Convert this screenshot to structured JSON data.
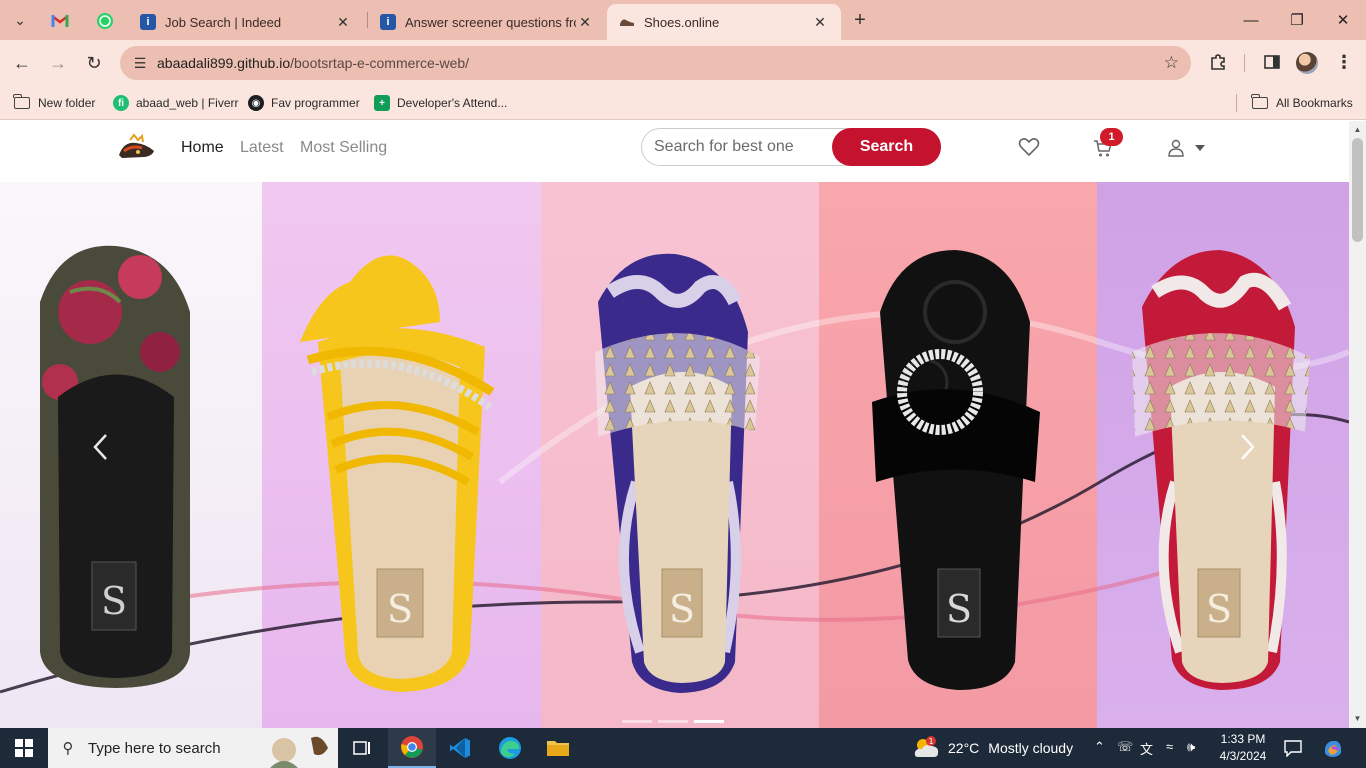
{
  "browser": {
    "tabs": [
      {
        "title": "Job Search | Indeed",
        "icon": "indeed-icon"
      },
      {
        "title": "Answer screener questions from",
        "icon": "indeed-icon"
      },
      {
        "title": "Shoes.online",
        "icon": "shoe-icon",
        "active": true
      }
    ],
    "pinned_tabs": [
      "gmail-icon",
      "whatsapp-icon"
    ],
    "url_host": "abaadali899.github.io",
    "url_path": "/bootsrtap-e-commerce-web/",
    "bookmarks": [
      {
        "label": "New folder",
        "icon": "folder-icon"
      },
      {
        "label": "abaad_web | Fiverr",
        "icon": "fiverr-icon"
      },
      {
        "label": "Fav programmer",
        "icon": "github-icon"
      },
      {
        "label": "Developer's Attend...",
        "icon": "sheets-icon"
      }
    ],
    "all_bookmarks_label": "All Bookmarks"
  },
  "site": {
    "nav_links": [
      "Home",
      "Latest",
      "Most Selling"
    ],
    "search_placeholder": "Search for best one",
    "search_button": "Search",
    "cart_count": "1",
    "brand_color": "#c4122f"
  },
  "carousel": {
    "slide_count": 3,
    "active_slide": 3,
    "panels": [
      {
        "product": "embroidered floral mule",
        "bg": "#f3eef6"
      },
      {
        "product": "yellow strappy sandal with rhinestones",
        "bg": "#efc4ec"
      },
      {
        "product": "purple studded clear slide",
        "bg": "#f5c0d0"
      },
      {
        "product": "black slide with crystal ring",
        "bg": "#f7a9b0"
      },
      {
        "product": "red studded clear slide",
        "bg": "#c9a4e6"
      }
    ]
  },
  "taskbar": {
    "search_placeholder": "Type here to search",
    "weather_temp": "22°C",
    "weather_desc": "Mostly cloudy",
    "weather_alert": "1",
    "time": "1:33 PM",
    "date": "4/3/2024"
  }
}
